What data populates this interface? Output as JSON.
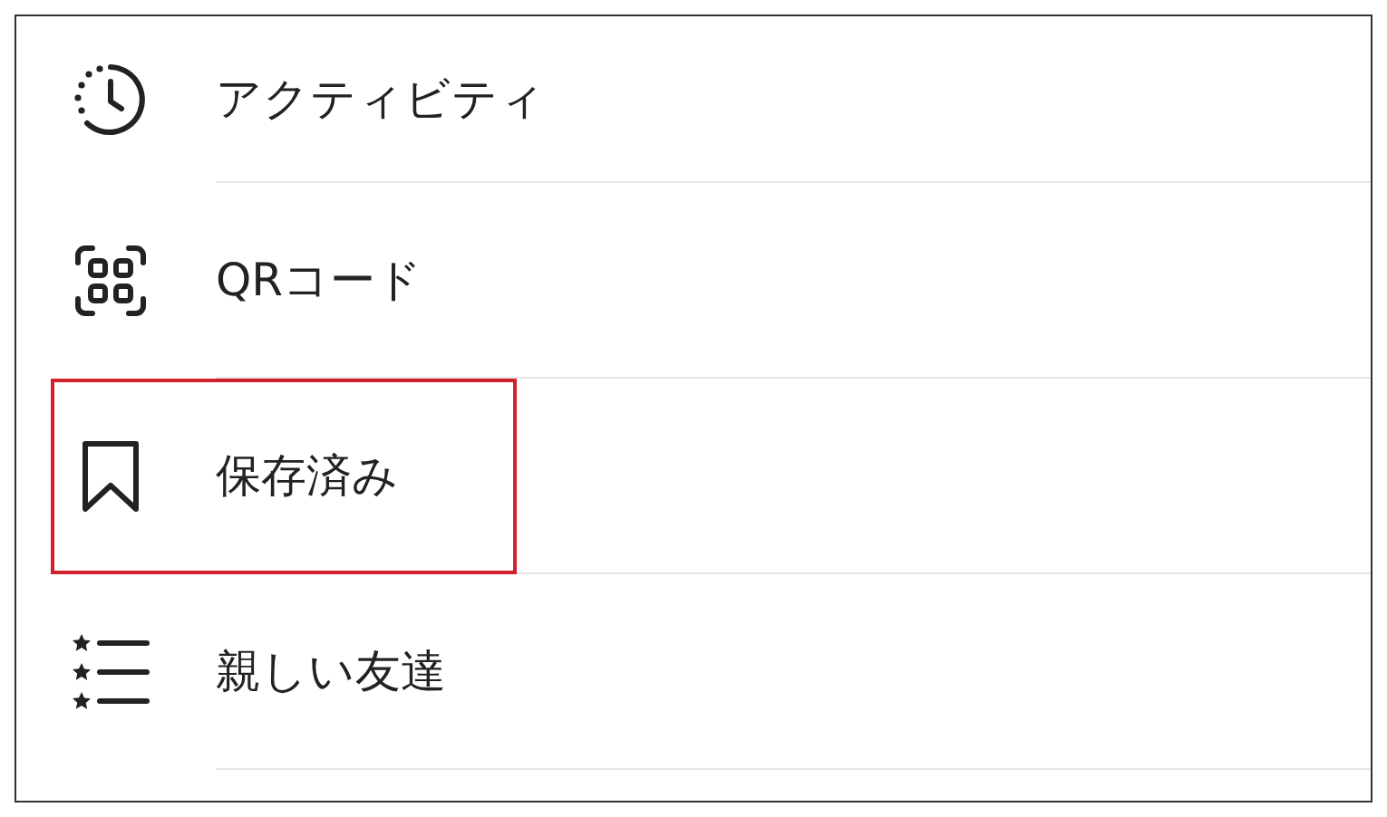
{
  "menu": {
    "items": [
      {
        "kind": "activity",
        "label": "アクティビティ",
        "highlighted": false
      },
      {
        "kind": "qr",
        "label": "QRコード",
        "highlighted": false
      },
      {
        "kind": "saved",
        "label": "保存済み",
        "highlighted": true
      },
      {
        "kind": "close-friends",
        "label": "親しい友達",
        "highlighted": false
      }
    ]
  }
}
